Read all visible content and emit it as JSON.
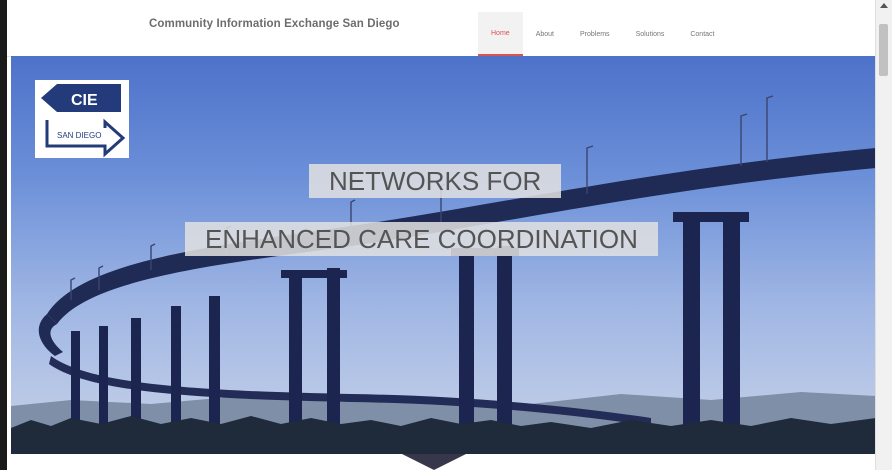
{
  "site": {
    "brand": "Community Information Exchange San Diego"
  },
  "nav": {
    "items": [
      {
        "label": "Home",
        "active": true
      },
      {
        "label": "About",
        "active": false
      },
      {
        "label": "Problems",
        "active": false
      },
      {
        "label": "Solutions",
        "active": false
      },
      {
        "label": "Contact",
        "active": false
      }
    ]
  },
  "logo": {
    "top_text": "CIE",
    "bottom_text": "SAN DIEGO",
    "color": "#233b7a"
  },
  "hero": {
    "line1": "NETWORKS FOR",
    "line2": "ENHANCED CARE COORDINATION"
  },
  "colors": {
    "accent": "#d9534f",
    "bridge": "#1f2a55",
    "sky_top": "#4d72c9",
    "sky_bottom": "#c9d3e8"
  }
}
